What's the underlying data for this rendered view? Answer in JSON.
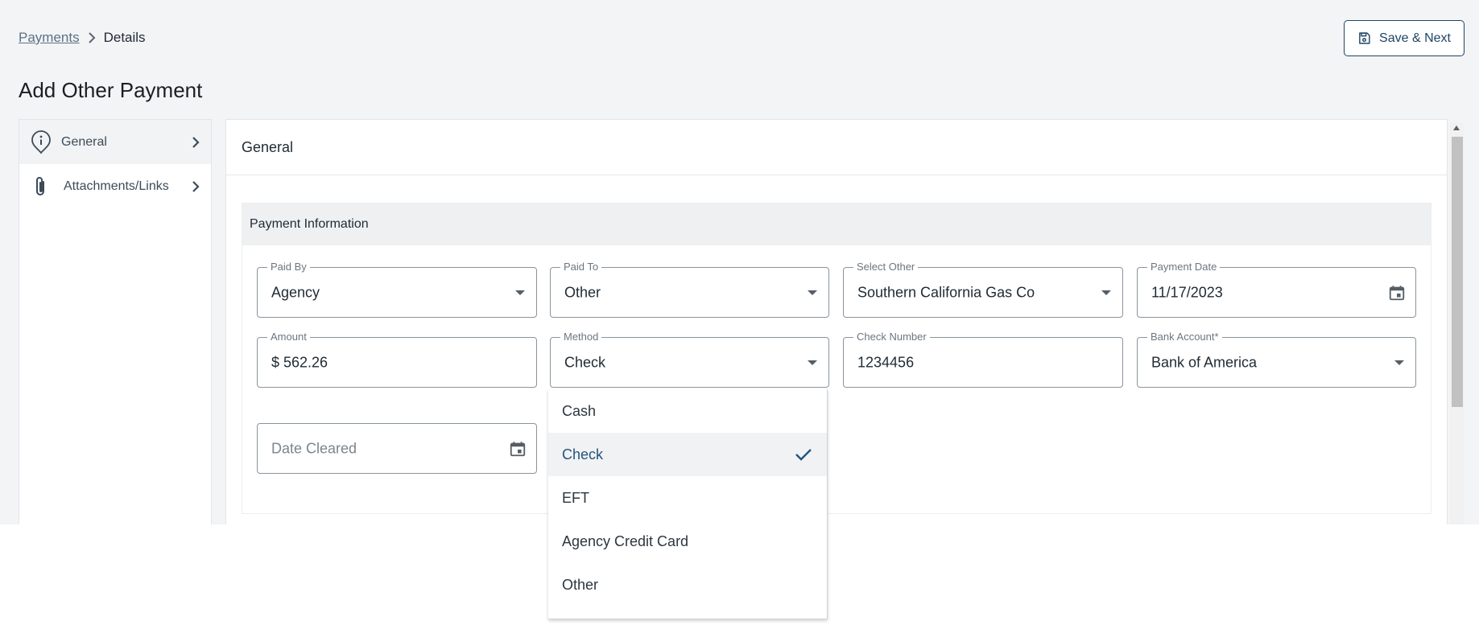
{
  "breadcrumb": {
    "parent": "Payments",
    "current": "Details"
  },
  "toolbar": {
    "save_next_label": "Save & Next"
  },
  "page": {
    "title": "Add Other Payment"
  },
  "sidebar": {
    "items": [
      {
        "label": "General",
        "icon": "info-pin-icon",
        "active": true
      },
      {
        "label": "Attachments/Links",
        "icon": "paperclip-icon",
        "active": false
      }
    ]
  },
  "main": {
    "panel_title": "General",
    "section_title": "Payment Information",
    "fields": {
      "paid_by": {
        "label": "Paid By",
        "value": "Agency"
      },
      "paid_to": {
        "label": "Paid To",
        "value": "Other"
      },
      "select_other": {
        "label": "Select Other",
        "value": "Southern California Gas Co"
      },
      "payment_date": {
        "label": "Payment Date",
        "value": "11/17/2023"
      },
      "amount": {
        "label": "Amount",
        "value": "$ 562.26"
      },
      "method": {
        "label": "Method",
        "value": "Check"
      },
      "check_number": {
        "label": "Check Number",
        "value": "1234456"
      },
      "bank_account": {
        "label": "Bank Account*",
        "value": "Bank of America"
      },
      "date_cleared": {
        "placeholder": "Date Cleared"
      }
    }
  },
  "method_dropdown": {
    "options": [
      "Cash",
      "Check",
      "EFT",
      "Agency Credit Card",
      "Other"
    ],
    "selected": "Check"
  },
  "colors": {
    "accent": "#1d4466",
    "selected_text": "#24547d",
    "background": "#f3f4f6"
  }
}
